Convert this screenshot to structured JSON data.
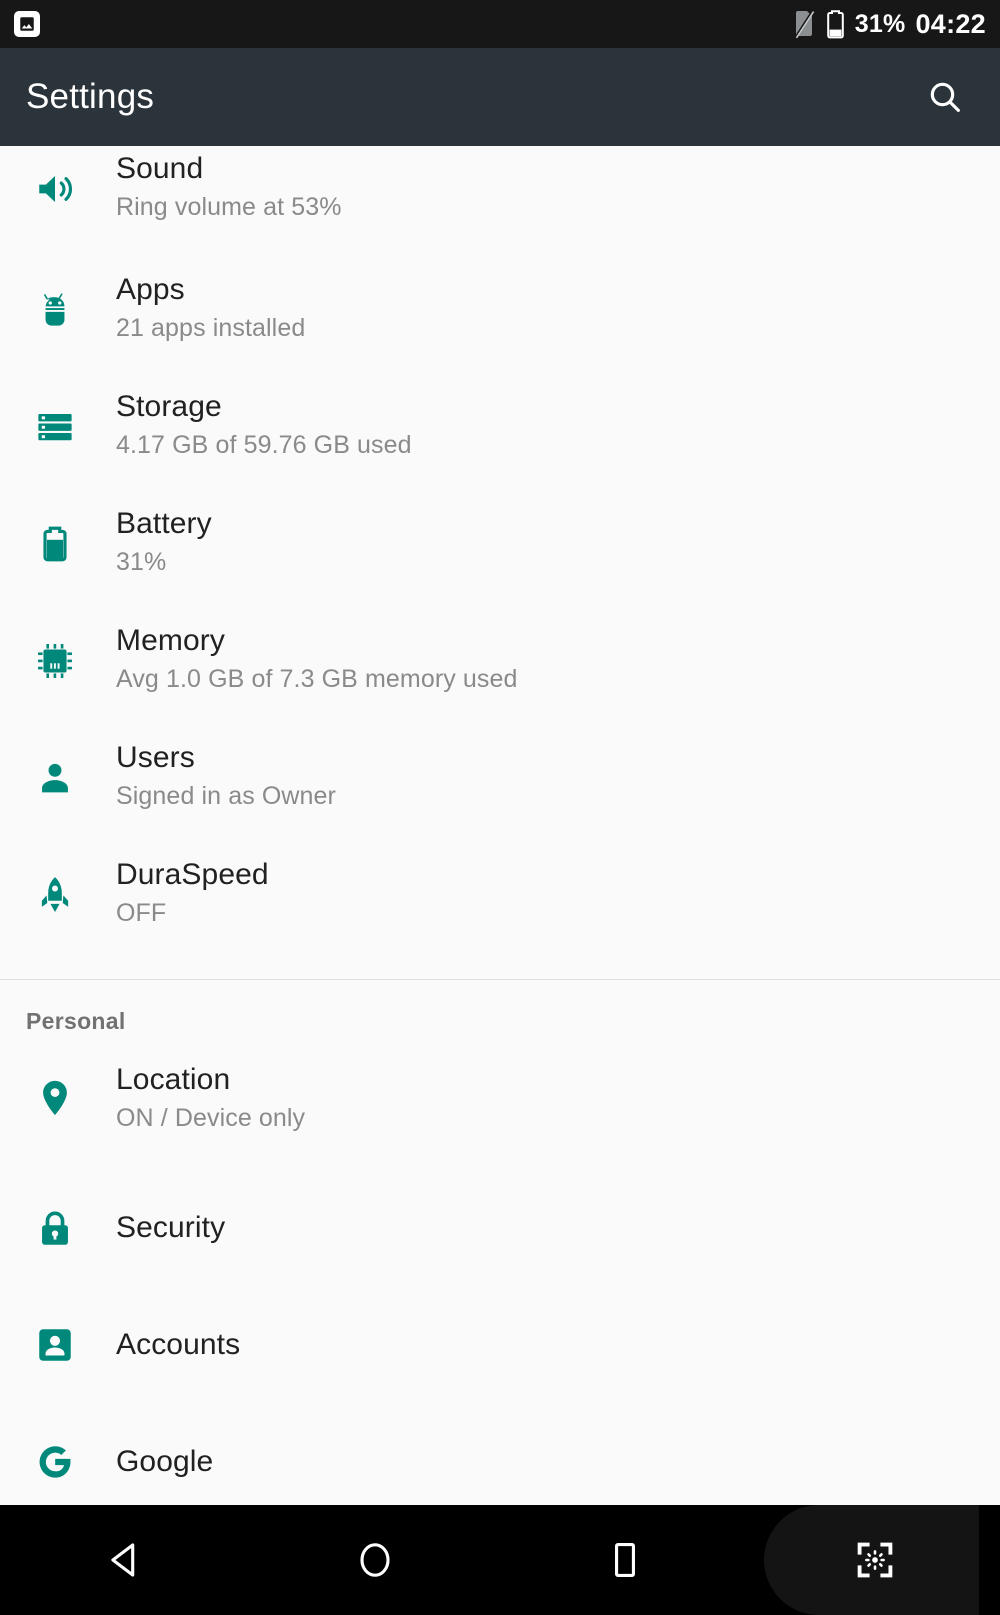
{
  "status_bar": {
    "notification_icon": "screenshot-image-icon",
    "sim_icon": "no-sim-icon",
    "battery_icon": "battery-icon",
    "battery_level": "31%",
    "time": "04:22"
  },
  "app_bar": {
    "title": "Settings",
    "search_icon": "search-icon"
  },
  "colors": {
    "accent_teal": "#00897b",
    "app_bar_bg": "#2b343a",
    "status_bar_bg": "#171717",
    "list_bg": "#fafafa",
    "title_text": "#212121",
    "summary_text": "#8a8a8a",
    "section_header_text": "#727272",
    "divider": "#e0e0e0",
    "nav_bar_bg": "#000000"
  },
  "sections": [
    {
      "header": null,
      "items": [
        {
          "icon": "sound-volume-icon",
          "title": "Sound",
          "summary": "Ring volume at 53%"
        },
        {
          "icon": "android-apps-icon",
          "title": "Apps",
          "summary": "21 apps installed"
        },
        {
          "icon": "storage-icon",
          "title": "Storage",
          "summary": "4.17 GB of 59.76 GB used"
        },
        {
          "icon": "battery-icon",
          "title": "Battery",
          "summary": "31%"
        },
        {
          "icon": "memory-chip-icon",
          "title": "Memory",
          "summary": "Avg 1.0 GB of 7.3 GB memory used"
        },
        {
          "icon": "user-person-icon",
          "title": "Users",
          "summary": "Signed in as Owner"
        },
        {
          "icon": "rocket-icon",
          "title": "DuraSpeed",
          "summary": "OFF"
        }
      ]
    },
    {
      "header": "Personal",
      "items": [
        {
          "icon": "location-pin-icon",
          "title": "Location",
          "summary": "ON / Device only"
        },
        {
          "icon": "lock-icon",
          "title": "Security",
          "summary": null
        },
        {
          "icon": "accounts-icon",
          "title": "Accounts",
          "summary": null
        },
        {
          "icon": "google-g-icon",
          "title": "Google",
          "summary": null
        }
      ]
    }
  ],
  "nav_bar": {
    "buttons": [
      {
        "name": "back-button",
        "icon": "back-triangle-icon"
      },
      {
        "name": "home-button",
        "icon": "home-circle-icon"
      },
      {
        "name": "recents-button",
        "icon": "recents-square-icon"
      },
      {
        "name": "screenshot-button",
        "icon": "screenshot-capture-icon"
      }
    ]
  }
}
